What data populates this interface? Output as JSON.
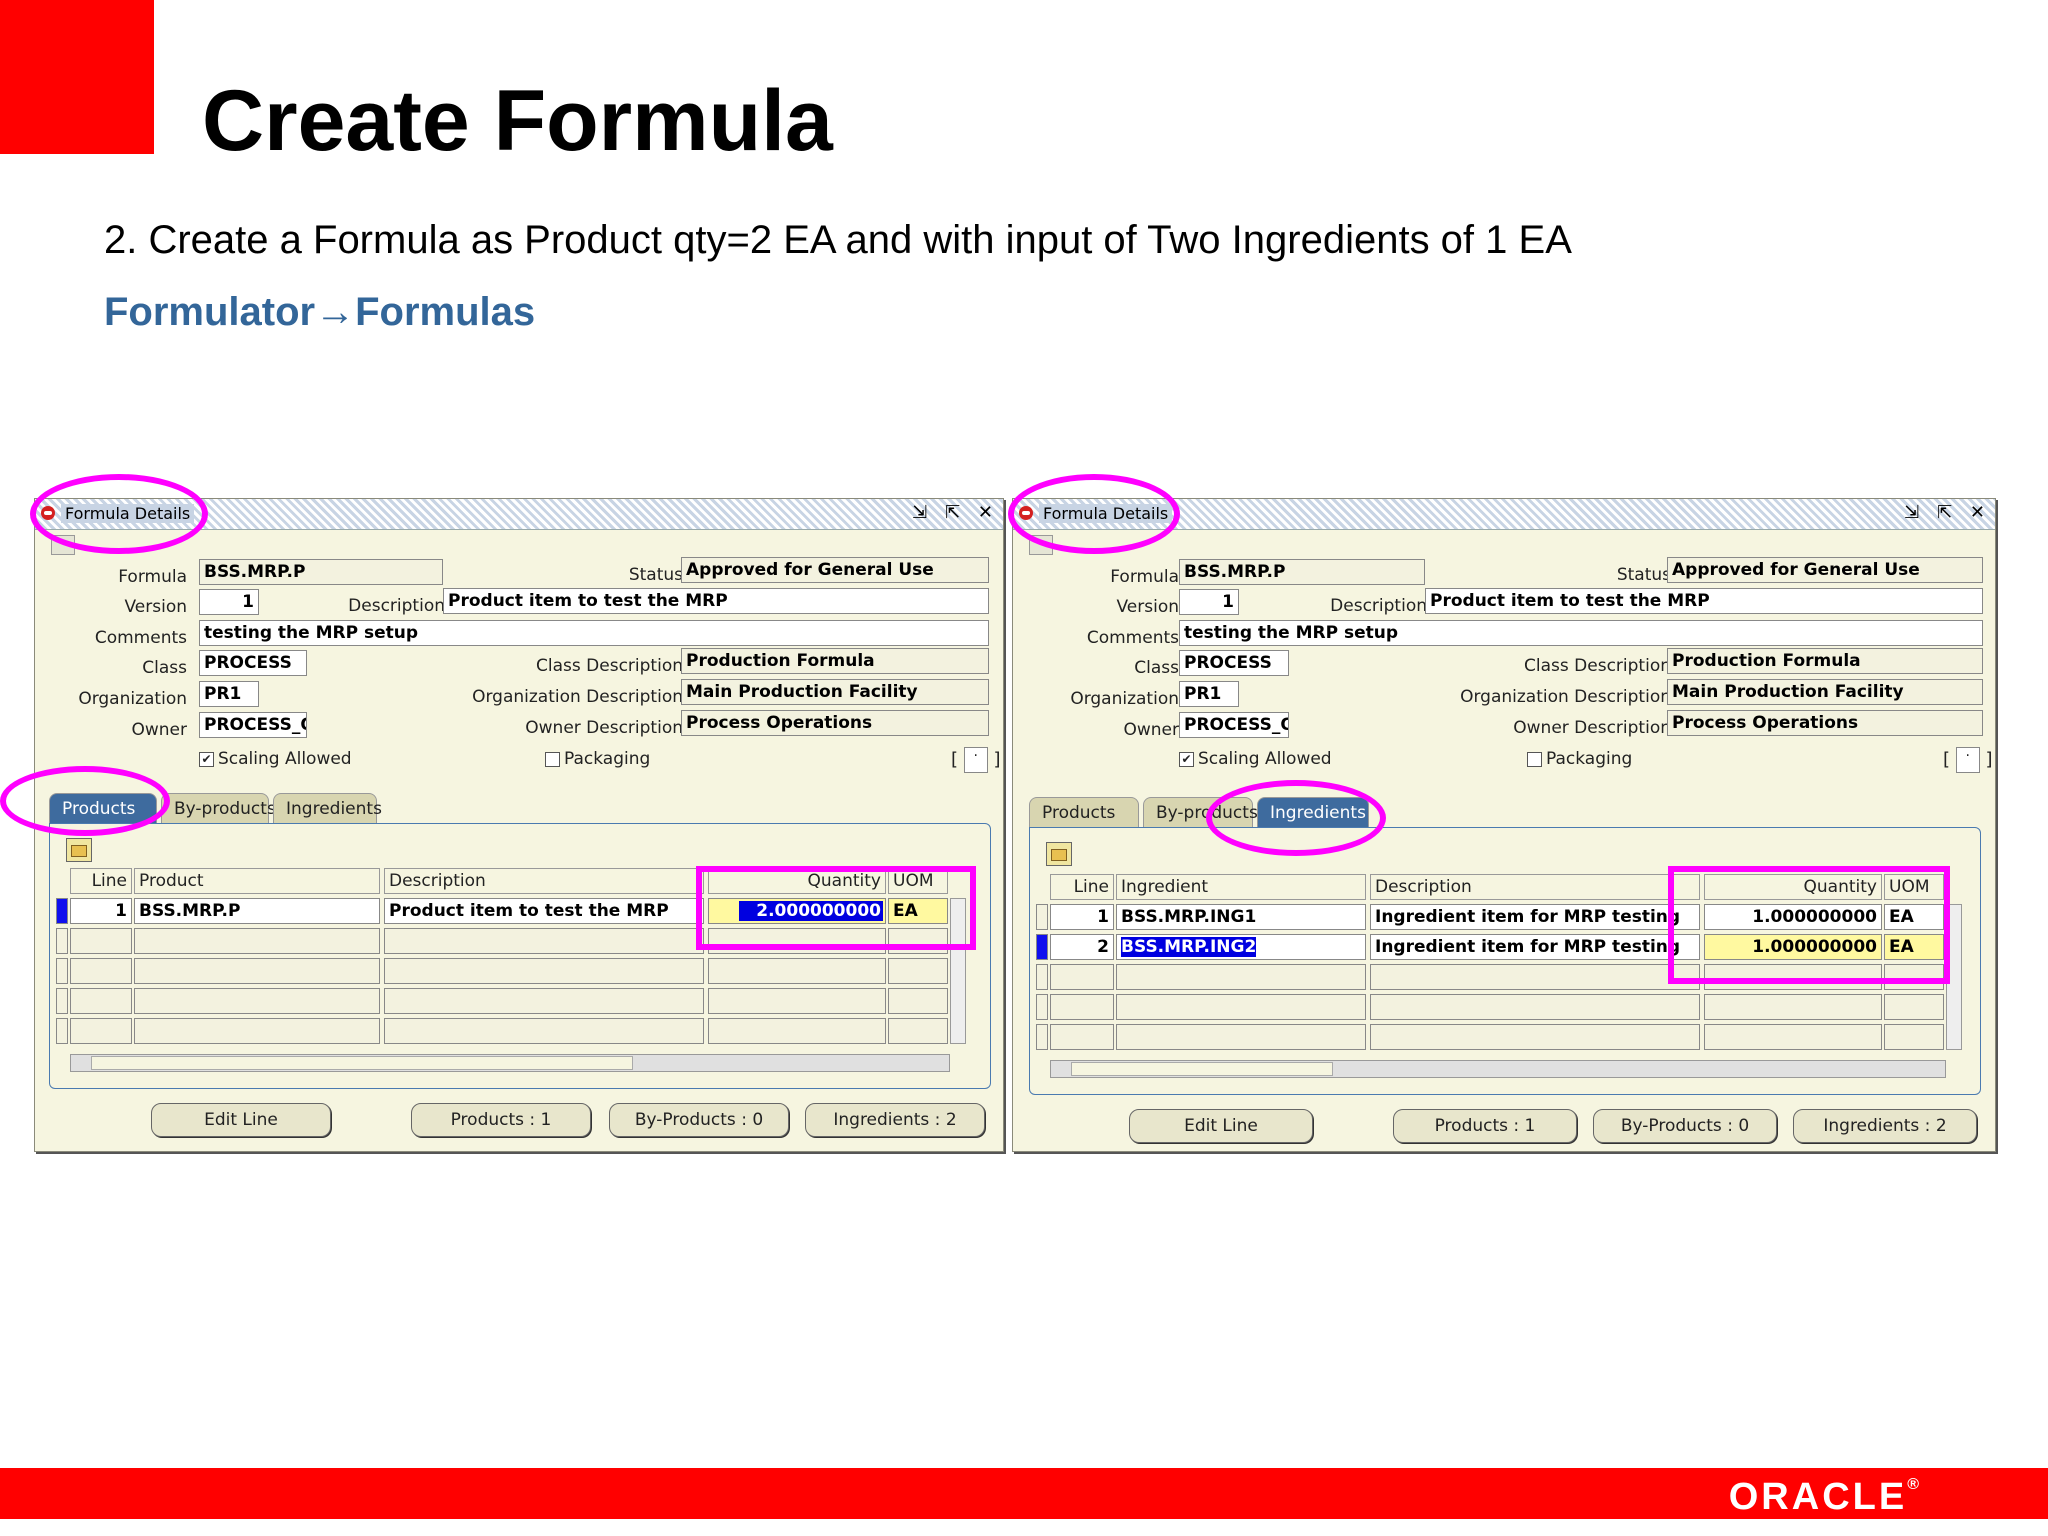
{
  "slide": {
    "title": "Create Formula",
    "subtitle": "2. Create a Formula as Product qty=2 EA and with input of Two Ingredients of 1 EA",
    "nav_from": "Formulator",
    "nav_arrow": "→",
    "nav_to": "Formulas",
    "logo": "ORACLE",
    "logo_mark": "®"
  },
  "colors": {
    "accent_red": "#ff0000",
    "nav_blue": "#336699",
    "highlight": "#ff00ff",
    "active_tab": "#3e6b9e"
  },
  "left_window": {
    "title": "Formula Details",
    "controls": "⇲ ⇱ ✕",
    "labels": {
      "formula": "Formula",
      "version": "Version",
      "comments": "Comments",
      "class": "Class",
      "organization": "Organization",
      "owner": "Owner",
      "status": "Status",
      "description": "Description",
      "class_description": "Class Description",
      "organization_description": "Organization Description",
      "owner_description": "Owner Description",
      "scaling_allowed": "Scaling Allowed",
      "packaging": "Packaging"
    },
    "values": {
      "formula": "BSS.MRP.P",
      "version": "1",
      "comments": "testing the MRP setup",
      "class": "PROCESS",
      "organization": "PR1",
      "owner": "PROCESS_O",
      "status": "Approved for General Use",
      "description": "Product item to test the MRP",
      "class_description": "Production Formula",
      "organization_description": "Main Production Facility",
      "owner_description": "Process Operations",
      "scaling_allowed": "✔",
      "packaging": "",
      "bracket_open": "[",
      "bracket_value": "·",
      "bracket_close": "]"
    },
    "tabs": [
      "Products",
      "By-products",
      "Ingredients"
    ],
    "active_tab": "Products",
    "grid": {
      "headers": {
        "line": "Line",
        "item": "Product",
        "description": "Description",
        "quantity": "Quantity",
        "uom": "UOM"
      },
      "rows": [
        {
          "line": "1",
          "item": "BSS.MRP.P",
          "description": "Product item to test the MRP",
          "quantity": "2.000000000",
          "uom": "EA"
        }
      ]
    },
    "buttons": {
      "edit_line": "Edit Line",
      "products": "Products : 1",
      "by_products": "By-Products : 0",
      "ingredients": "Ingredients : 2"
    }
  },
  "right_window": {
    "title": "Formula Details",
    "controls": "⇲ ⇱ ✕",
    "labels": {
      "formula": "Formula",
      "version": "Version",
      "comments": "Comments",
      "class": "Class",
      "organization": "Organization",
      "owner": "Owner",
      "status": "Status",
      "description": "Description",
      "class_description": "Class Description",
      "organization_description": "Organization Description",
      "owner_description": "Owner Description",
      "scaling_allowed": "Scaling Allowed",
      "packaging": "Packaging"
    },
    "values": {
      "formula": "BSS.MRP.P",
      "version": "1",
      "comments": "testing the MRP setup",
      "class": "PROCESS",
      "organization": "PR1",
      "owner": "PROCESS_O",
      "status": "Approved for General Use",
      "description": "Product item to test the MRP",
      "class_description": "Production Formula",
      "organization_description": "Main Production Facility",
      "owner_description": "Process Operations",
      "scaling_allowed": "✔",
      "packaging": "",
      "bracket_open": "[",
      "bracket_value": "·",
      "bracket_close": "]"
    },
    "tabs": [
      "Products",
      "By-products",
      "Ingredients"
    ],
    "active_tab": "Ingredients",
    "grid": {
      "headers": {
        "line": "Line",
        "item": "Ingredient",
        "description": "Description",
        "quantity": "Quantity",
        "uom": "UOM"
      },
      "rows": [
        {
          "line": "1",
          "item": "BSS.MRP.ING1",
          "description": "Ingredient item for MRP testing",
          "quantity": "1.000000000",
          "uom": "EA"
        },
        {
          "line": "2",
          "item": "BSS.MRP.ING2",
          "description": "Ingredient item for MRP testing",
          "quantity": "1.000000000",
          "uom": "EA"
        }
      ]
    },
    "buttons": {
      "edit_line": "Edit Line",
      "products": "Products : 1",
      "by_products": "By-Products : 0",
      "ingredients": "Ingredients : 2"
    }
  }
}
